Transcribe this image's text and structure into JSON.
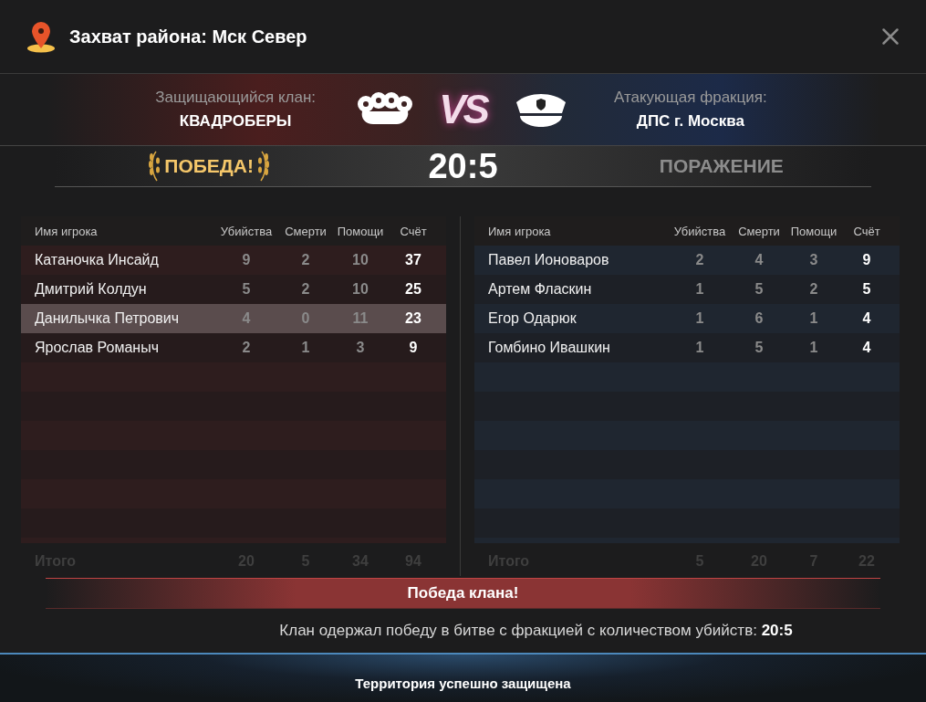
{
  "title": "Захват района: Мск Север",
  "defender": {
    "label": "Защищающийся клан:",
    "name": "КВАДРОБЕРЫ"
  },
  "vs": "VS",
  "attacker": {
    "label": "Атакующая фракция:",
    "name": "ДПС г. Москва"
  },
  "result": {
    "left": "ПОБЕДА!",
    "score": "20:5",
    "right": "ПОРАЖЕНИЕ"
  },
  "teams": [
    {
      "kind": "defender",
      "columns": [
        "Имя игрока",
        "Убийства",
        "Смерти",
        "Помощи",
        "Счёт"
      ],
      "rows": [
        {
          "name": "Катаночка Инсайд",
          "kills": "9",
          "deaths": "2",
          "assists": "10",
          "score": "37",
          "selected": false
        },
        {
          "name": "Дмитрий Колдун",
          "kills": "5",
          "deaths": "2",
          "assists": "10",
          "score": "25",
          "selected": false
        },
        {
          "name": "Данилычка Петрович",
          "kills": "4",
          "deaths": "0",
          "assists": "11",
          "score": "23",
          "selected": true
        },
        {
          "name": "Ярослав Романыч",
          "kills": "2",
          "deaths": "1",
          "assists": "3",
          "score": "9",
          "selected": false
        }
      ],
      "totals": {
        "label": "Итого",
        "values": [
          "20",
          "5",
          "34",
          "94"
        ]
      }
    },
    {
      "kind": "attacker",
      "columns": [
        "Имя игрока",
        "Убийства",
        "Смерти",
        "Помощи",
        "Счёт"
      ],
      "rows": [
        {
          "name": "Павел Ионоваров",
          "kills": "2",
          "deaths": "4",
          "assists": "3",
          "score": "9",
          "selected": false
        },
        {
          "name": "Артем Фласкин",
          "kills": "1",
          "deaths": "5",
          "assists": "2",
          "score": "5",
          "selected": false
        },
        {
          "name": "Егор Одарюк",
          "kills": "1",
          "deaths": "6",
          "assists": "1",
          "score": "4",
          "selected": false
        },
        {
          "name": "Гомбино Ивашкин",
          "kills": "1",
          "deaths": "5",
          "assists": "1",
          "score": "4",
          "selected": false
        }
      ],
      "totals": {
        "label": "Итого",
        "values": [
          "5",
          "20",
          "7",
          "22"
        ]
      }
    }
  ],
  "banner": "Победа клана!",
  "message": "Клан одержал победу в битве с фракцией с количеством убийств: **20:5**",
  "footer": "Территория успешно защищена"
}
